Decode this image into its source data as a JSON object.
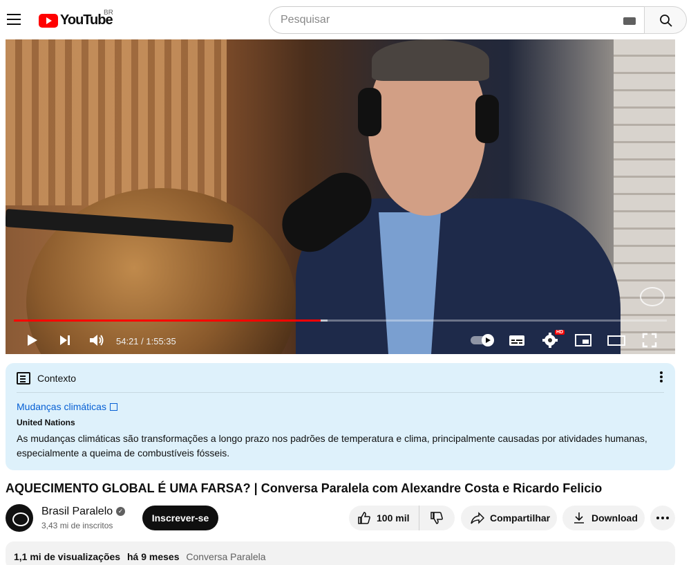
{
  "header": {
    "logo_text": "YouTube",
    "region": "BR",
    "search_placeholder": "Pesquisar"
  },
  "player": {
    "time_display": "54:21 / 1:55:35",
    "progress_fraction": 0.4703,
    "buffered_fraction": 0.48,
    "hd_badge": "HD",
    "progress_color": "#ff0000"
  },
  "context": {
    "header": "Contexto",
    "link_text": "Mudanças climáticas",
    "source": "United Nations",
    "body": "As mudanças climáticas são transformações a longo prazo nos padrões de temperatura e clima, principalmente causadas por atividades humanas, especialmente a queima de combustíveis fósseis.",
    "background_color": "#def1fb",
    "link_color": "#065fd4"
  },
  "video": {
    "title": "AQUECIMENTO GLOBAL É UMA FARSA? | Conversa Paralela com Alexandre Costa e Ricardo Felicio"
  },
  "channel": {
    "name": "Brasil Paralelo",
    "subscribers": "3,43 mi de inscritos",
    "subscribe_label": "Inscrever-se"
  },
  "actions": {
    "like_count": "100 mil",
    "share_label": "Compartilhar",
    "download_label": "Download"
  },
  "description": {
    "views": "1,1 mi de visualizações",
    "date": "há 9 meses",
    "hashtag": "Conversa Paralela"
  }
}
